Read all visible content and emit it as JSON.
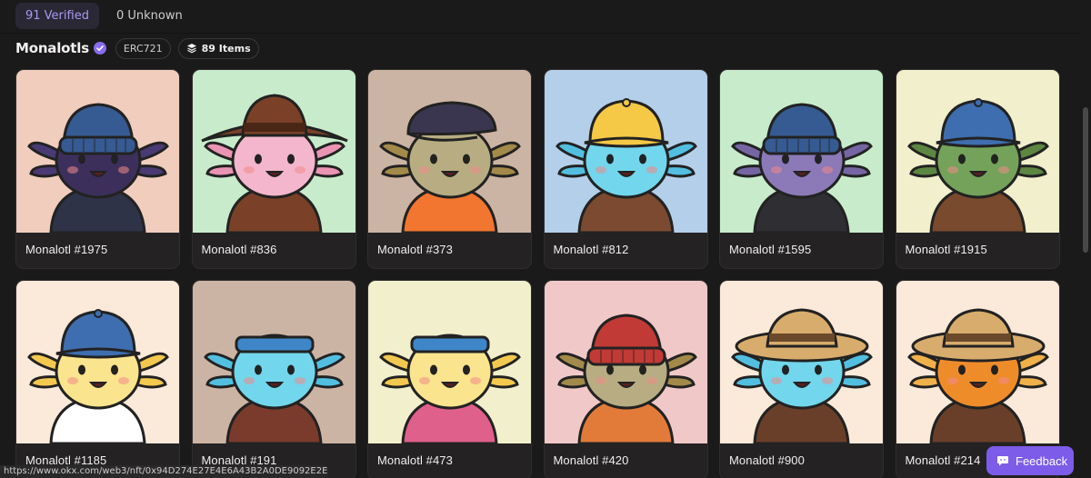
{
  "tabs": [
    {
      "label": "91 Verified"
    },
    {
      "label": "0 Unknown"
    }
  ],
  "collection": {
    "name": "Monalotls",
    "standard": "ERC721",
    "items_count": "89 Items"
  },
  "cards": [
    {
      "label": "Monalotl #1975",
      "bg": "#f1cdbd",
      "skin": "#3d2f5c",
      "hat": "#365a92",
      "hat_type": "beanie",
      "shirt": "#2f3348",
      "gills": "#4a3a74"
    },
    {
      "label": "Monalotl #836",
      "bg": "#c8eccb",
      "skin": "#f4b6cc",
      "hat": "#7a4128",
      "hat_type": "cowboy",
      "shirt": "#7a4128",
      "gills": "#ea94b4"
    },
    {
      "label": "Monalotl #373",
      "bg": "#ccb4a4",
      "skin": "#b8ad82",
      "hat": "#3b3650",
      "hat_type": "flat",
      "shirt": "#f2762f",
      "gills": "#a3894a"
    },
    {
      "label": "Monalotl #812",
      "bg": "#b4cfe9",
      "skin": "#72d6ec",
      "hat": "#f5c845",
      "hat_type": "cap",
      "shirt": "#7b4a30",
      "gills": "#53bfe0"
    },
    {
      "label": "Monalotl #1595",
      "bg": "#c8eccb",
      "skin": "#8b79b8",
      "hat": "#365a92",
      "hat_type": "beanie",
      "shirt": "#2f2f33",
      "gills": "#7566a3"
    },
    {
      "label": "Monalotl #1915",
      "bg": "#f1efcc",
      "skin": "#74a25a",
      "hat": "#3e6eb0",
      "hat_type": "cap",
      "shirt": "#7a4a2e",
      "gills": "#5d8642"
    },
    {
      "label": "Monalotl #1185",
      "bg": "#fbe9da",
      "skin": "#fae48e",
      "hat": "#3e6eb0",
      "hat_type": "cap",
      "shirt": "#ffffff",
      "gills": "#f3c84f"
    },
    {
      "label": "Monalotl #191",
      "bg": "#ccb4a4",
      "skin": "#72d6ec",
      "hat": "#3e86c8",
      "hat_type": "band",
      "shirt": "#7a3a2c",
      "gills": "#53bfe0"
    },
    {
      "label": "Monalotl #473",
      "bg": "#f1efcc",
      "skin": "#fae48e",
      "hat": "#3e86c8",
      "hat_type": "band",
      "shirt": "#e0608c",
      "gills": "#f3c84f"
    },
    {
      "label": "Monalotl #420",
      "bg": "#f1c8c8",
      "skin": "#b8ad82",
      "hat": "#c23a35",
      "hat_type": "beanie",
      "shirt": "#e27b3a",
      "gills": "#a3894a"
    },
    {
      "label": "Monalotl #900",
      "bg": "#fbe9da",
      "skin": "#72d6ec",
      "hat": "#d8ac6c",
      "hat_type": "straw",
      "shirt": "#6a3f2a",
      "gills": "#53bfe0"
    },
    {
      "label": "Monalotl #214",
      "bg": "#fbe9da",
      "skin": "#ef8c2a",
      "hat": "#d8ac6c",
      "hat_type": "straw",
      "shirt": "#6a3f2a",
      "gills": "#f0b04a"
    }
  ],
  "feedback": {
    "label": "Feedback"
  },
  "status_url": "https://www.okx.com/web3/nft/0x94D274E27E4E6A43B2A0DE9092E2E2620ABE3254"
}
